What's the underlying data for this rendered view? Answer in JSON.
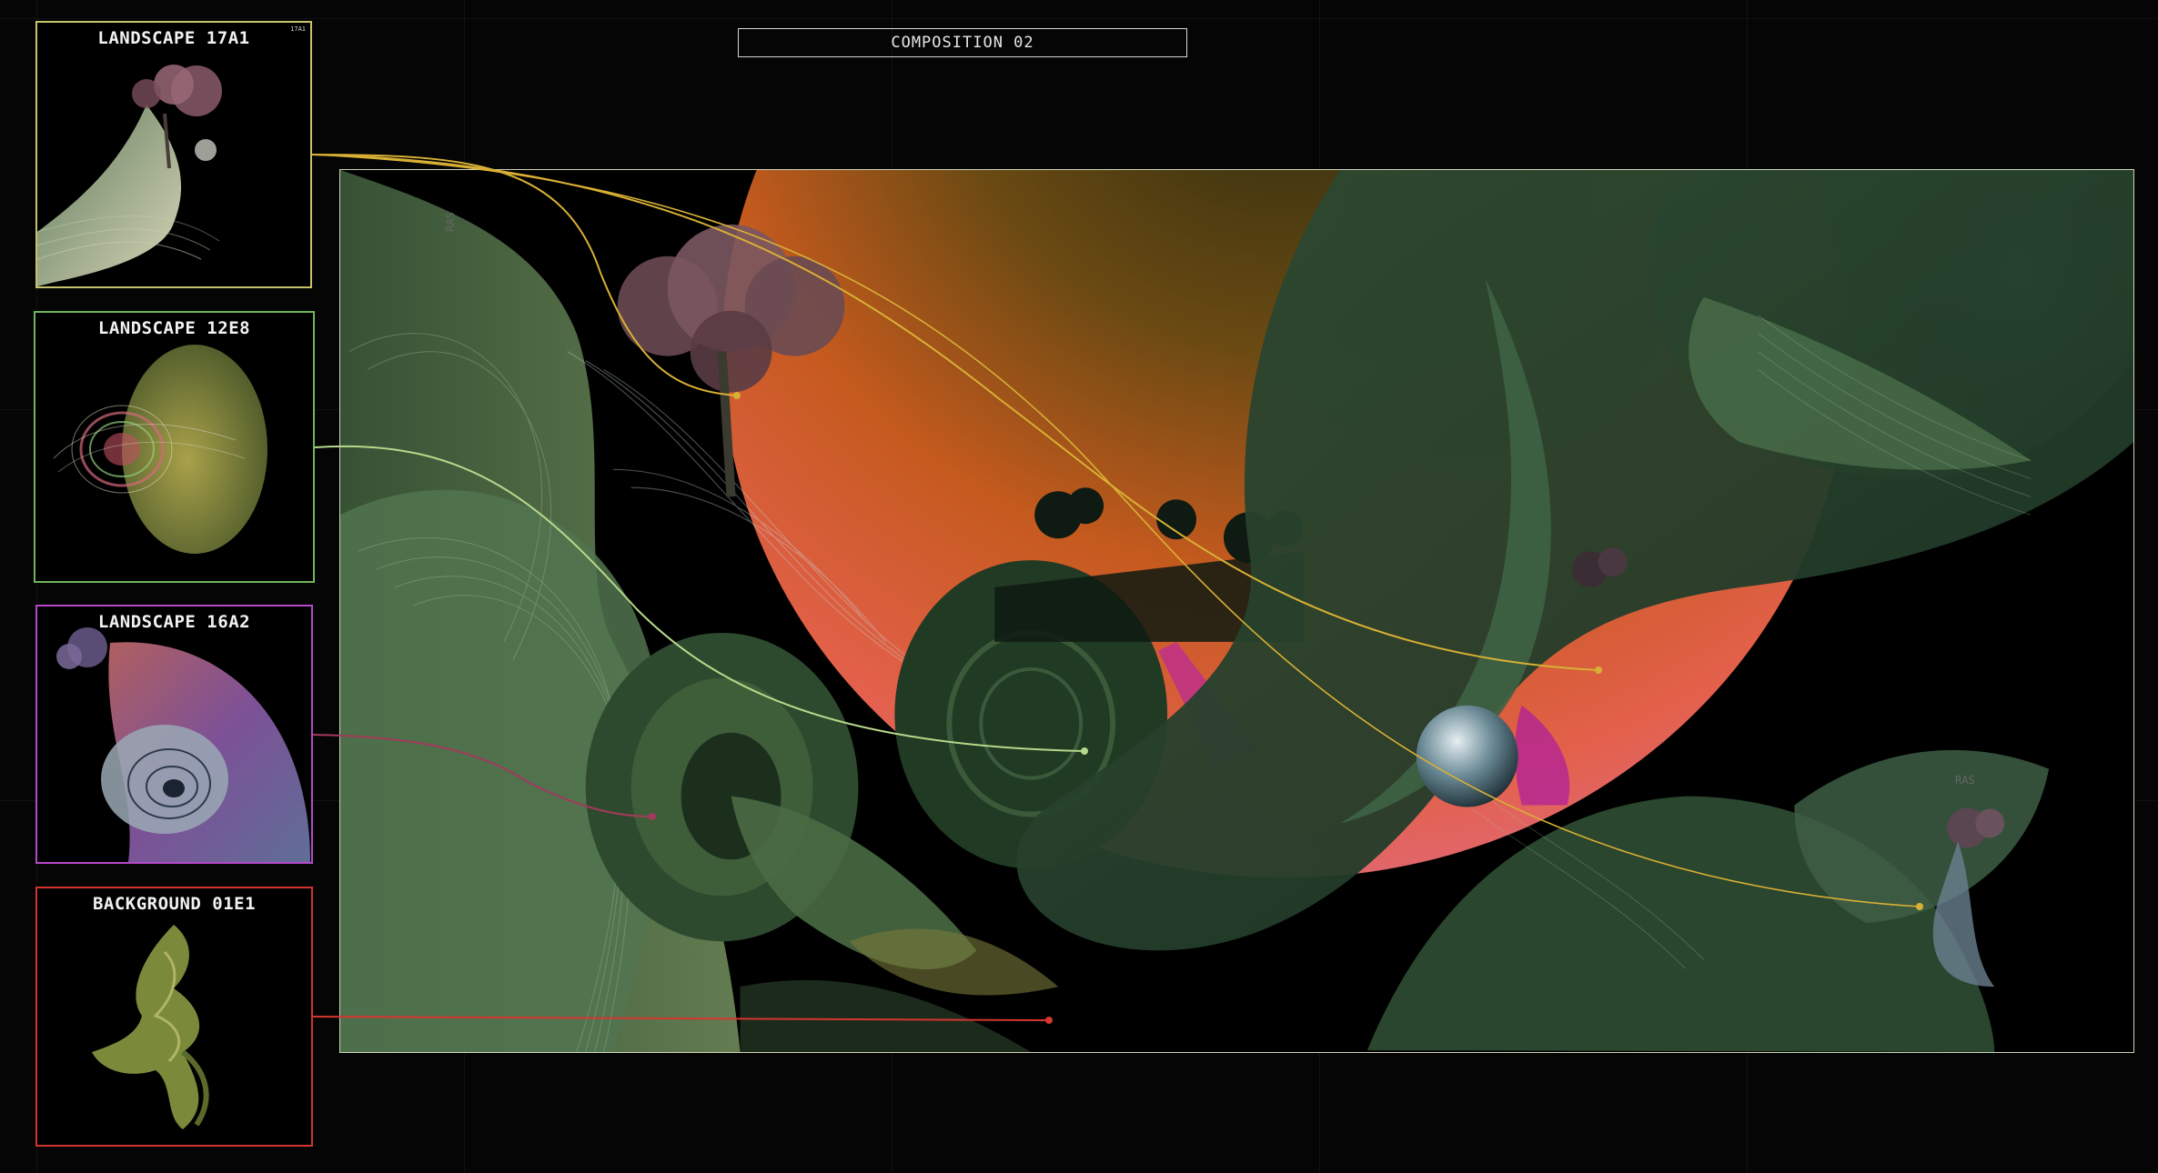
{
  "composition": {
    "title": "COMPOSITION 02"
  },
  "layers": [
    {
      "label": "LANDSCAPE 17A1",
      "tag": "17A1",
      "color": "#c7c36a"
    },
    {
      "label": "LANDSCAPE 12E8",
      "color": "#6fb65a"
    },
    {
      "label": "LANDSCAPE 16A2",
      "color": "#b548c9"
    },
    {
      "label": "BACKGROUND 01E1",
      "color": "#d3332f"
    }
  ],
  "canvas_marks": {
    "ras_left": "RAS",
    "ras_right": "RAS"
  },
  "connector_colors": {
    "yellow": "#d8b035",
    "green": "#b7d98a",
    "pink": "#a23a5a",
    "red": "#d6362f"
  }
}
